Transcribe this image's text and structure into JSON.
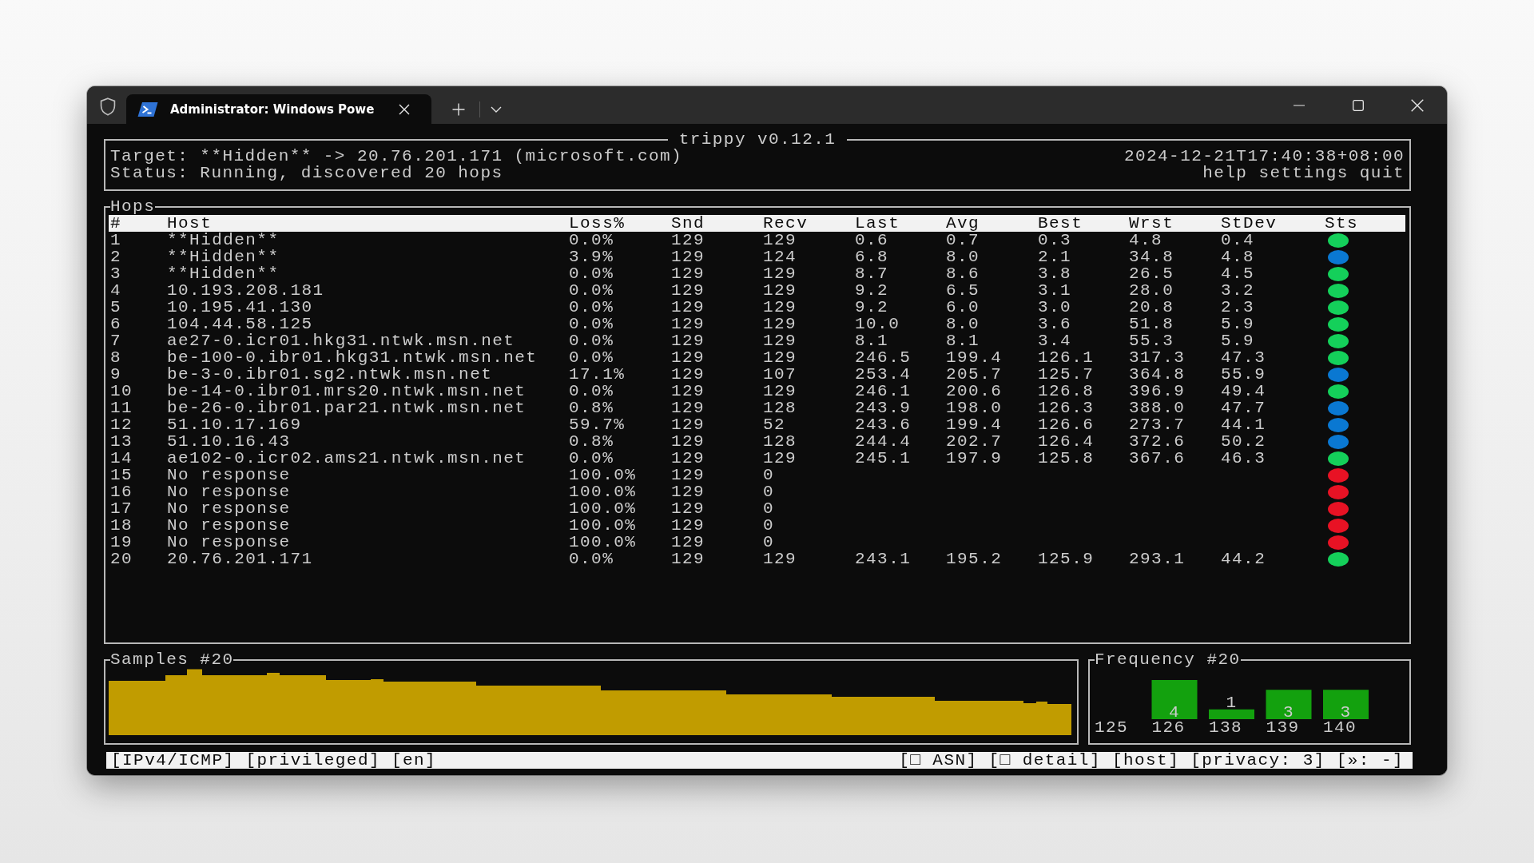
{
  "window": {
    "tabs": [
      {
        "label": "Administrator: Windows Powe",
        "selected": true
      }
    ]
  },
  "header": {
    "title": "trippy v0.12.1",
    "target": "Target: **Hidden** -> 20.76.201.171 (microsoft.com)",
    "status": "Status: Running, discovered 20 hops",
    "timestamp": "2024-12-21T17:40:38+08:00",
    "hints": "help settings quit"
  },
  "hops": {
    "title": "Hops",
    "columns": [
      "#",
      "Host",
      "Loss%",
      "Snd",
      "Recv",
      "Last",
      "Avg",
      "Best",
      "Wrst",
      "StDev",
      "Sts"
    ],
    "rows": [
      {
        "cells": [
          "1",
          "**Hidden**",
          "0.0%",
          "129",
          "129",
          "0.6",
          "0.7",
          "0.3",
          "4.8",
          "0.4"
        ],
        "color": "#14d05a"
      },
      {
        "cells": [
          "2",
          "**Hidden**",
          "3.9%",
          "129",
          "124",
          "6.8",
          "8.0",
          "2.1",
          "34.8",
          "4.8"
        ],
        "color": "#0a78d2"
      },
      {
        "cells": [
          "3",
          "**Hidden**",
          "0.0%",
          "129",
          "129",
          "8.7",
          "8.6",
          "3.8",
          "26.5",
          "4.5"
        ],
        "color": "#14d05a"
      },
      {
        "cells": [
          "4",
          "10.193.208.181",
          "0.0%",
          "129",
          "129",
          "9.2",
          "6.5",
          "3.1",
          "28.0",
          "3.2"
        ],
        "color": "#14d05a"
      },
      {
        "cells": [
          "5",
          "10.195.41.130",
          "0.0%",
          "129",
          "129",
          "9.2",
          "6.0",
          "3.0",
          "20.8",
          "2.3"
        ],
        "color": "#14d05a"
      },
      {
        "cells": [
          "6",
          "104.44.58.125",
          "0.0%",
          "129",
          "129",
          "10.0",
          "8.0",
          "3.6",
          "51.8",
          "5.9"
        ],
        "color": "#14d05a"
      },
      {
        "cells": [
          "7",
          "ae27-0.icr01.hkg31.ntwk.msn.net",
          "0.0%",
          "129",
          "129",
          "8.1",
          "8.1",
          "3.4",
          "55.3",
          "5.9"
        ],
        "color": "#14d05a"
      },
      {
        "cells": [
          "8",
          "be-100-0.ibr01.hkg31.ntwk.msn.net",
          "0.0%",
          "129",
          "129",
          "246.5",
          "199.4",
          "126.1",
          "317.3",
          "47.3"
        ],
        "color": "#14d05a"
      },
      {
        "cells": [
          "9",
          "be-3-0.ibr01.sg2.ntwk.msn.net",
          "17.1%",
          "129",
          "107",
          "253.4",
          "205.7",
          "125.7",
          "364.8",
          "55.9"
        ],
        "color": "#0a78d2"
      },
      {
        "cells": [
          "10",
          "be-14-0.ibr01.mrs20.ntwk.msn.net",
          "0.0%",
          "129",
          "129",
          "246.1",
          "200.6",
          "126.8",
          "396.9",
          "49.4"
        ],
        "color": "#14d05a"
      },
      {
        "cells": [
          "11",
          "be-26-0.ibr01.par21.ntwk.msn.net",
          "0.8%",
          "129",
          "128",
          "243.9",
          "198.0",
          "126.3",
          "388.0",
          "47.7"
        ],
        "color": "#0a78d2"
      },
      {
        "cells": [
          "12",
          "51.10.17.169",
          "59.7%",
          "129",
          "52",
          "243.6",
          "199.4",
          "126.6",
          "273.7",
          "44.1"
        ],
        "color": "#0a78d2"
      },
      {
        "cells": [
          "13",
          "51.10.16.43",
          "0.8%",
          "129",
          "128",
          "244.4",
          "202.7",
          "126.4",
          "372.6",
          "50.2"
        ],
        "color": "#0a78d2"
      },
      {
        "cells": [
          "14",
          "ae102-0.icr02.ams21.ntwk.msn.net",
          "0.0%",
          "129",
          "129",
          "245.1",
          "197.9",
          "125.8",
          "367.6",
          "46.3"
        ],
        "color": "#14d05a"
      },
      {
        "cells": [
          "15",
          "No response",
          "100.0%",
          "129",
          "0"
        ],
        "color": "#e81224"
      },
      {
        "cells": [
          "16",
          "No response",
          "100.0%",
          "129",
          "0"
        ],
        "color": "#e81224"
      },
      {
        "cells": [
          "17",
          "No response",
          "100.0%",
          "129",
          "0"
        ],
        "color": "#e81224"
      },
      {
        "cells": [
          "18",
          "No response",
          "100.0%",
          "129",
          "0"
        ],
        "color": "#e81224"
      },
      {
        "cells": [
          "19",
          "No response",
          "100.0%",
          "129",
          "0"
        ],
        "color": "#e81224"
      },
      {
        "cells": [
          "20",
          "20.76.201.171",
          "0.0%",
          "129",
          "129",
          "243.1",
          "195.2",
          "125.9",
          "293.1",
          "44.2"
        ],
        "color": "#14d05a"
      }
    ]
  },
  "samples": {
    "title": "Samples #20"
  },
  "frequency": {
    "chart_data": {
      "type": "bar",
      "title": "Frequency #20",
      "categories": [
        "125",
        "126",
        "138",
        "139",
        "140"
      ],
      "values": [
        null,
        4,
        1,
        3,
        3
      ],
      "data_labels": true
    }
  },
  "status_bar": {
    "left": [
      "[IPv4/ICMP]",
      "[privileged]",
      "[en]"
    ],
    "right": [
      "[□ ASN]",
      "[□ detail]",
      "[host]",
      "[privacy: 3]",
      "[»: -]"
    ]
  }
}
